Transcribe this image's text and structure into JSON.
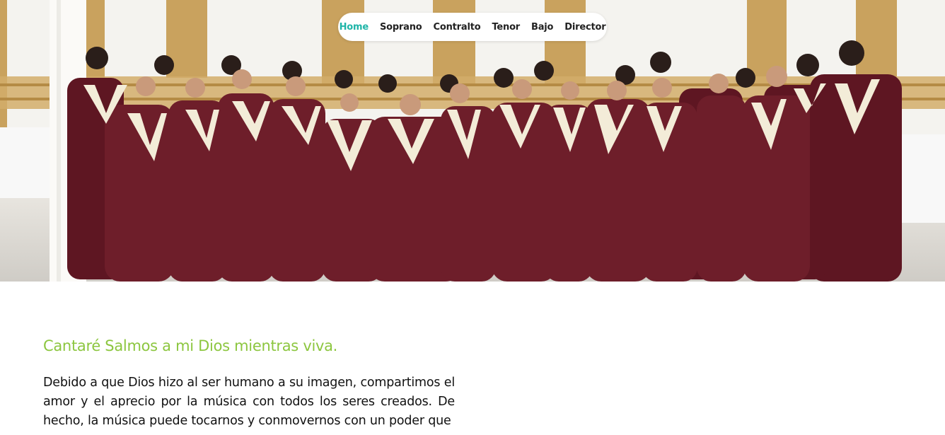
{
  "nav": {
    "items": [
      {
        "label": "Home",
        "active": true
      },
      {
        "label": "Soprano",
        "active": false
      },
      {
        "label": "Contralto",
        "active": false
      },
      {
        "label": "Tenor",
        "active": false
      },
      {
        "label": "Bajo",
        "active": false
      },
      {
        "label": "Director",
        "active": false
      }
    ]
  },
  "hero": {
    "image": "choir-group-photo",
    "robe_color": "#6e1e2a",
    "stole_color": "#f3ecd8"
  },
  "main": {
    "heading": "Cantaré Salmos a mi Dios mientras viva.",
    "paragraph": "Debido a que Dios hizo al ser humano a su imagen, compartimos el amor y el aprecio por la música con todos los seres creados. De hecho, la música puede tocarnos y conmovernos con un poder que"
  },
  "colors": {
    "accent_nav": "#1fb5a8",
    "heading": "#8cc63f",
    "text": "#111111"
  }
}
